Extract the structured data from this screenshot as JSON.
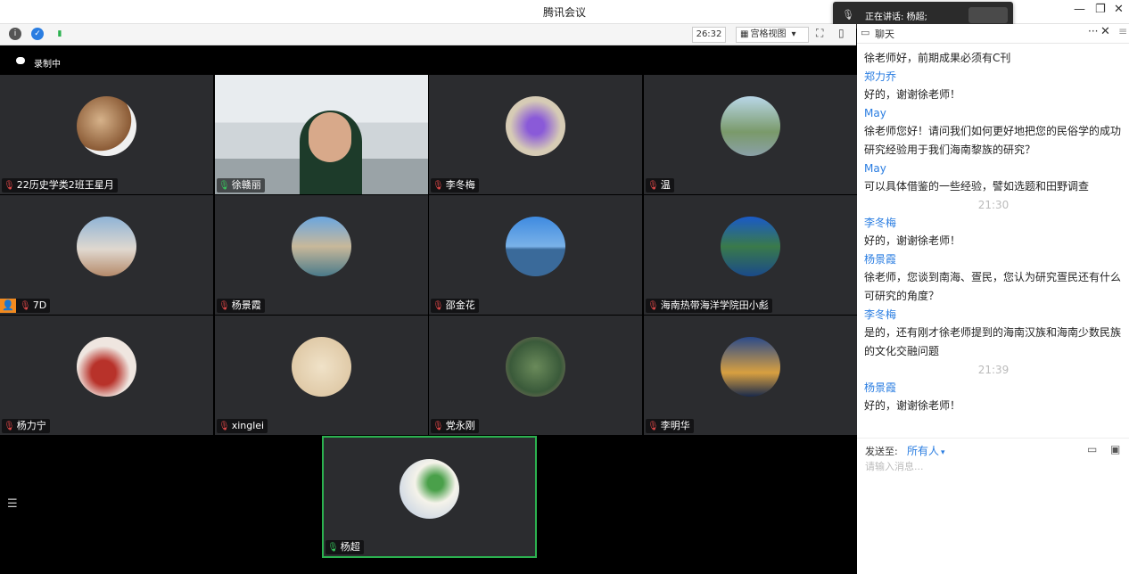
{
  "window": {
    "title": "腾讯会议"
  },
  "speaking": {
    "text": "正在讲话: 杨超;"
  },
  "toolbar": {
    "timer": "26:32",
    "view_label": "宫格视图",
    "chat_tab": "聊天"
  },
  "recording": {
    "label": "录制中"
  },
  "participants": [
    {
      "name": "22历史学类2班王星月",
      "muted": true
    },
    {
      "name": "徐赣丽",
      "muted": false
    },
    {
      "name": "李冬梅",
      "muted": true
    },
    {
      "name": "温",
      "muted": true
    },
    {
      "name": "7D",
      "muted": true,
      "host": true
    },
    {
      "name": "杨景霞",
      "muted": true
    },
    {
      "name": "邵金花",
      "muted": true
    },
    {
      "name": "海南热带海洋学院田小彪",
      "muted": true
    },
    {
      "name": "杨力宁",
      "muted": true
    },
    {
      "name": "xinglei",
      "muted": true
    },
    {
      "name": "党永刚",
      "muted": true
    },
    {
      "name": "李明华",
      "muted": true
    }
  ],
  "self": {
    "name": "杨超"
  },
  "chat": {
    "messages": [
      {
        "type": "text",
        "text": "徐老师好，前期成果必须有C刊"
      },
      {
        "type": "name",
        "text": "郑力乔"
      },
      {
        "type": "text",
        "text": "好的，谢谢徐老师！"
      },
      {
        "type": "name",
        "text": "May"
      },
      {
        "type": "text",
        "text": "徐老师您好！请问我们如何更好地把您的民俗学的成功"
      },
      {
        "type": "text",
        "text": "研究经验用于我们海南黎族的研究？"
      },
      {
        "type": "name",
        "text": "May"
      },
      {
        "type": "text",
        "text": "可以具体借鉴的一些经验，譬如选题和田野调查"
      },
      {
        "type": "time",
        "text": "21:30"
      },
      {
        "type": "name",
        "text": "李冬梅"
      },
      {
        "type": "text",
        "text": "好的，谢谢徐老师！"
      },
      {
        "type": "name",
        "text": "杨景霞"
      },
      {
        "type": "text",
        "text": "徐老师，您谈到南海、疍民，您认为研究疍民还有什么"
      },
      {
        "type": "text",
        "text": "可研究的角度？"
      },
      {
        "type": "name",
        "text": "李冬梅"
      },
      {
        "type": "text",
        "text": "是的，还有刚才徐老师提到的海南汉族和海南少数民族"
      },
      {
        "type": "text",
        "text": "的文化交融问题"
      },
      {
        "type": "time",
        "text": "21:39"
      },
      {
        "type": "name",
        "text": "杨景霞"
      },
      {
        "type": "text",
        "text": "好的，谢谢徐老师！"
      }
    ],
    "send_to_label": "发送至:",
    "send_to_value": "所有人",
    "input_placeholder": "请输入消息..."
  }
}
